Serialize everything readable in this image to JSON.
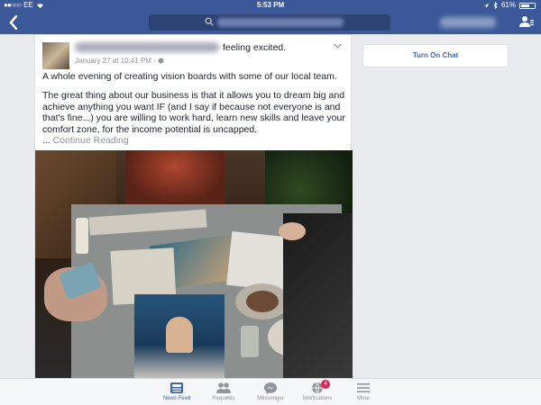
{
  "status_bar": {
    "carrier": "EE",
    "time": "5:53 PM",
    "battery": "61%"
  },
  "nav": {
    "back_icon": "chevron-left-icon",
    "search_icon": "search-icon",
    "friends_icon": "friend-requests-icon"
  },
  "post": {
    "feeling": "feeling excited.",
    "timestamp": "January 27 at 10:41 PM ·",
    "paragraph1": "A whole evening of creating vision boards with some of our local team.",
    "paragraph2": "The great thing about our business is that it allows you to dream big and achieve anything you want IF (and I say if because not everyone is and that's fine...) you are willing to work hard, learn new skills and leave your comfort zone, for the income potential is uncapped.",
    "ellipsis": "... ",
    "continue_reading": "Continue Reading"
  },
  "sidebar": {
    "chat_button": "Turn On Chat"
  },
  "tabbar": {
    "items": [
      {
        "label": "News Feed",
        "icon": "news-feed-icon",
        "active": true
      },
      {
        "label": "Requests",
        "icon": "requests-icon",
        "active": false
      },
      {
        "label": "Messenger",
        "icon": "messenger-icon",
        "active": false
      },
      {
        "label": "Notifications",
        "icon": "globe-icon",
        "active": false,
        "badge": "4"
      },
      {
        "label": "More",
        "icon": "menu-icon",
        "active": false
      }
    ]
  },
  "colors": {
    "brand": "#3b5998",
    "link": "#4267b2",
    "badge": "#e0245e"
  }
}
